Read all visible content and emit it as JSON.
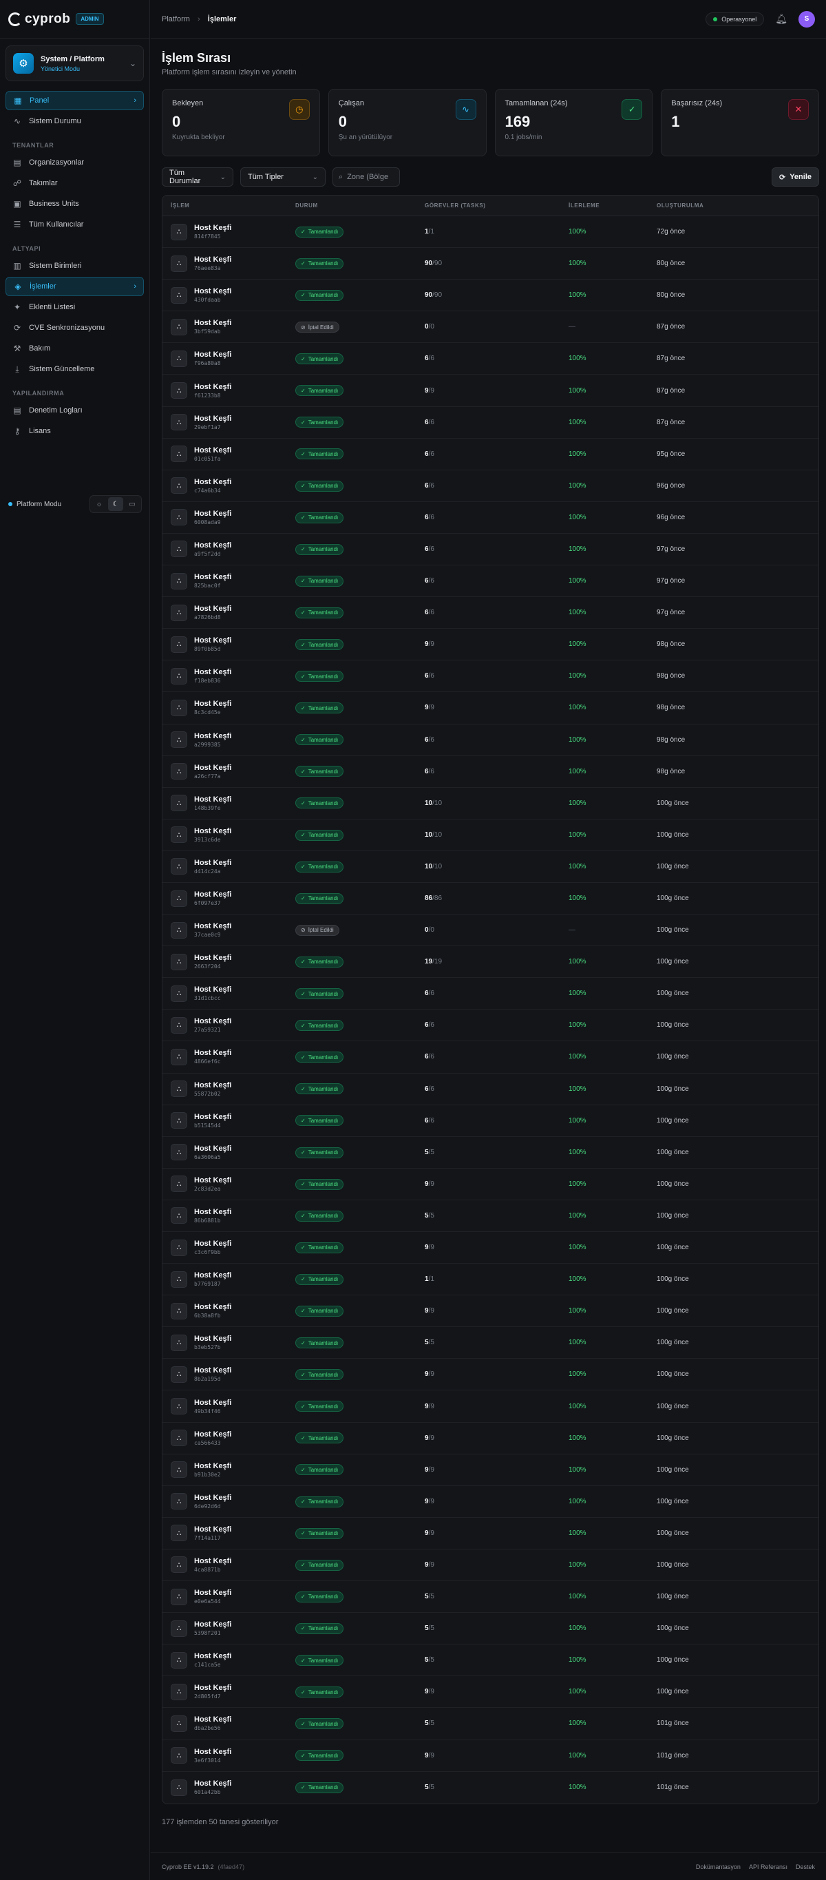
{
  "app": {
    "logo": "cyprob",
    "badge": "ADMIN"
  },
  "tenant": {
    "name": "System / Platform",
    "mode": "Yönetici Modu"
  },
  "nav": {
    "top": [
      {
        "label": "Panel",
        "icon": "grid-icon",
        "glyph": "▦",
        "active": true
      },
      {
        "label": "Sistem Durumu",
        "icon": "activity-icon",
        "glyph": "∿",
        "active": false
      }
    ],
    "sections": [
      {
        "title": "TENANTLAR",
        "items": [
          {
            "label": "Organizasyonlar",
            "icon": "building-icon",
            "glyph": "▤"
          },
          {
            "label": "Takımlar",
            "icon": "users-icon",
            "glyph": "☍"
          },
          {
            "label": "Business Units",
            "icon": "briefcase-icon",
            "glyph": "▣"
          },
          {
            "label": "Tüm Kullanıcılar",
            "icon": "user-list-icon",
            "glyph": "☰"
          }
        ]
      },
      {
        "title": "ALTYAPI",
        "items": [
          {
            "label": "Sistem Birimleri",
            "icon": "server-icon",
            "glyph": "▥"
          },
          {
            "label": "İşlemler",
            "icon": "layers-icon",
            "glyph": "◈",
            "active": true
          },
          {
            "label": "Eklenti Listesi",
            "icon": "puzzle-icon",
            "glyph": "✦"
          },
          {
            "label": "CVE Senkronizasyonu",
            "icon": "sync-icon",
            "glyph": "⟳"
          },
          {
            "label": "Bakım",
            "icon": "wrench-icon",
            "glyph": "⚒"
          },
          {
            "label": "Sistem Güncelleme",
            "icon": "download-icon",
            "glyph": "⤓"
          }
        ]
      },
      {
        "title": "YAPILANDIRMA",
        "items": [
          {
            "label": "Denetim Logları",
            "icon": "log-icon",
            "glyph": "▤"
          },
          {
            "label": "Lisans",
            "icon": "key-icon",
            "glyph": "⚷"
          }
        ]
      }
    ],
    "platform_mode": "Platform Modu"
  },
  "topbar": {
    "crumb_root": "Platform",
    "crumb_current": "İşlemler",
    "status": "Operasyonel",
    "avatar_initial": "S"
  },
  "page": {
    "title": "İşlem Sırası",
    "subtitle": "Platform işlem sırasını izleyin ve yönetin"
  },
  "stats": [
    {
      "label": "Bekleyen",
      "value": "0",
      "hint": "Kuyrukta bekliyor",
      "icon": "clock-icon",
      "glyph": "◷",
      "color": "#f59e0b",
      "bg": "#3a2a0d",
      "border": "#6b4a12"
    },
    {
      "label": "Çalışan",
      "value": "0",
      "hint": "Şu an yürütülüyor",
      "icon": "pulse-icon",
      "glyph": "∿",
      "color": "#38bdf8",
      "bg": "#0d2a36",
      "border": "#14526b"
    },
    {
      "label": "Tamamlanan (24s)",
      "value": "169",
      "hint": "0.1 jobs/min",
      "icon": "check-circle-icon",
      "glyph": "✓",
      "color": "#4ade80",
      "bg": "#0f3a2b",
      "border": "#166343"
    },
    {
      "label": "Başarısız (24s)",
      "value": "1",
      "hint": "",
      "icon": "x-circle-icon",
      "glyph": "✕",
      "color": "#f43f5e",
      "bg": "#3a1019",
      "border": "#6b1a2b"
    }
  ],
  "filters": {
    "status": "Tüm Durumlar",
    "type": "Tüm Tipler",
    "zone_placeholder": "Zone (Bölge",
    "refresh": "Yenile"
  },
  "table": {
    "headers": [
      "İŞLEM",
      "DURUM",
      "GÖREVLER (TASKS)",
      "İLERLEME",
      "OLUŞTURULMA"
    ],
    "rows": [
      {
        "name": "Host Keşfi",
        "id": "814f7845",
        "status": "Tamamlandı",
        "done": "1",
        "total": "1",
        "progress": "100%",
        "created": "72g önce"
      },
      {
        "name": "Host Keşfi",
        "id": "76aee83a",
        "status": "Tamamlandı",
        "done": "90",
        "total": "90",
        "progress": "100%",
        "created": "80g önce"
      },
      {
        "name": "Host Keşfi",
        "id": "430fdaab",
        "status": "Tamamlandı",
        "done": "90",
        "total": "90",
        "progress": "100%",
        "created": "80g önce"
      },
      {
        "name": "Host Keşfi",
        "id": "3bf59dab",
        "status": "İptal Edildi",
        "done": "0",
        "total": "0",
        "progress": "—",
        "created": "87g önce"
      },
      {
        "name": "Host Keşfi",
        "id": "f96a80a8",
        "status": "Tamamlandı",
        "done": "6",
        "total": "6",
        "progress": "100%",
        "created": "87g önce"
      },
      {
        "name": "Host Keşfi",
        "id": "f61233b8",
        "status": "Tamamlandı",
        "done": "9",
        "total": "9",
        "progress": "100%",
        "created": "87g önce"
      },
      {
        "name": "Host Keşfi",
        "id": "29ebf1a7",
        "status": "Tamamlandı",
        "done": "6",
        "total": "6",
        "progress": "100%",
        "created": "87g önce"
      },
      {
        "name": "Host Keşfi",
        "id": "01c051fa",
        "status": "Tamamlandı",
        "done": "6",
        "total": "6",
        "progress": "100%",
        "created": "95g önce"
      },
      {
        "name": "Host Keşfi",
        "id": "c74a6b34",
        "status": "Tamamlandı",
        "done": "6",
        "total": "6",
        "progress": "100%",
        "created": "96g önce"
      },
      {
        "name": "Host Keşfi",
        "id": "6008ada9",
        "status": "Tamamlandı",
        "done": "6",
        "total": "6",
        "progress": "100%",
        "created": "96g önce"
      },
      {
        "name": "Host Keşfi",
        "id": "a9f5f2dd",
        "status": "Tamamlandı",
        "done": "6",
        "total": "6",
        "progress": "100%",
        "created": "97g önce"
      },
      {
        "name": "Host Keşfi",
        "id": "825bac0f",
        "status": "Tamamlandı",
        "done": "6",
        "total": "6",
        "progress": "100%",
        "created": "97g önce"
      },
      {
        "name": "Host Keşfi",
        "id": "a7826bd8",
        "status": "Tamamlandı",
        "done": "6",
        "total": "6",
        "progress": "100%",
        "created": "97g önce"
      },
      {
        "name": "Host Keşfi",
        "id": "89f0b85d",
        "status": "Tamamlandı",
        "done": "9",
        "total": "9",
        "progress": "100%",
        "created": "98g önce"
      },
      {
        "name": "Host Keşfi",
        "id": "f18eb836",
        "status": "Tamamlandı",
        "done": "6",
        "total": "6",
        "progress": "100%",
        "created": "98g önce"
      },
      {
        "name": "Host Keşfi",
        "id": "8c3cd45e",
        "status": "Tamamlandı",
        "done": "9",
        "total": "9",
        "progress": "100%",
        "created": "98g önce"
      },
      {
        "name": "Host Keşfi",
        "id": "a2999385",
        "status": "Tamamlandı",
        "done": "6",
        "total": "6",
        "progress": "100%",
        "created": "98g önce"
      },
      {
        "name": "Host Keşfi",
        "id": "a26cf77a",
        "status": "Tamamlandı",
        "done": "6",
        "total": "6",
        "progress": "100%",
        "created": "98g önce"
      },
      {
        "name": "Host Keşfi",
        "id": "148b39fe",
        "status": "Tamamlandı",
        "done": "10",
        "total": "10",
        "progress": "100%",
        "created": "100g önce"
      },
      {
        "name": "Host Keşfi",
        "id": "3913c6de",
        "status": "Tamamlandı",
        "done": "10",
        "total": "10",
        "progress": "100%",
        "created": "100g önce"
      },
      {
        "name": "Host Keşfi",
        "id": "d414c24a",
        "status": "Tamamlandı",
        "done": "10",
        "total": "10",
        "progress": "100%",
        "created": "100g önce"
      },
      {
        "name": "Host Keşfi",
        "id": "6f097e37",
        "status": "Tamamlandı",
        "done": "86",
        "total": "86",
        "progress": "100%",
        "created": "100g önce"
      },
      {
        "name": "Host Keşfi",
        "id": "37cae0c9",
        "status": "İptal Edildi",
        "done": "0",
        "total": "0",
        "progress": "—",
        "created": "100g önce"
      },
      {
        "name": "Host Keşfi",
        "id": "2663f204",
        "status": "Tamamlandı",
        "done": "19",
        "total": "19",
        "progress": "100%",
        "created": "100g önce"
      },
      {
        "name": "Host Keşfi",
        "id": "31d1cbcc",
        "status": "Tamamlandı",
        "done": "6",
        "total": "6",
        "progress": "100%",
        "created": "100g önce"
      },
      {
        "name": "Host Keşfi",
        "id": "27a59321",
        "status": "Tamamlandı",
        "done": "6",
        "total": "6",
        "progress": "100%",
        "created": "100g önce"
      },
      {
        "name": "Host Keşfi",
        "id": "4866ef6c",
        "status": "Tamamlandı",
        "done": "6",
        "total": "6",
        "progress": "100%",
        "created": "100g önce"
      },
      {
        "name": "Host Keşfi",
        "id": "55872b02",
        "status": "Tamamlandı",
        "done": "6",
        "total": "6",
        "progress": "100%",
        "created": "100g önce"
      },
      {
        "name": "Host Keşfi",
        "id": "b51545d4",
        "status": "Tamamlandı",
        "done": "6",
        "total": "6",
        "progress": "100%",
        "created": "100g önce"
      },
      {
        "name": "Host Keşfi",
        "id": "6a3606a5",
        "status": "Tamamlandı",
        "done": "5",
        "total": "5",
        "progress": "100%",
        "created": "100g önce"
      },
      {
        "name": "Host Keşfi",
        "id": "2c83d2ea",
        "status": "Tamamlandı",
        "done": "9",
        "total": "9",
        "progress": "100%",
        "created": "100g önce"
      },
      {
        "name": "Host Keşfi",
        "id": "86b6881b",
        "status": "Tamamlandı",
        "done": "5",
        "total": "5",
        "progress": "100%",
        "created": "100g önce"
      },
      {
        "name": "Host Keşfi",
        "id": "c3c6f9bb",
        "status": "Tamamlandı",
        "done": "9",
        "total": "9",
        "progress": "100%",
        "created": "100g önce"
      },
      {
        "name": "Host Keşfi",
        "id": "b7769187",
        "status": "Tamamlandı",
        "done": "1",
        "total": "1",
        "progress": "100%",
        "created": "100g önce"
      },
      {
        "name": "Host Keşfi",
        "id": "6b38a8fb",
        "status": "Tamamlandı",
        "done": "9",
        "total": "9",
        "progress": "100%",
        "created": "100g önce"
      },
      {
        "name": "Host Keşfi",
        "id": "b3eb527b",
        "status": "Tamamlandı",
        "done": "5",
        "total": "5",
        "progress": "100%",
        "created": "100g önce"
      },
      {
        "name": "Host Keşfi",
        "id": "8b2a195d",
        "status": "Tamamlandı",
        "done": "9",
        "total": "9",
        "progress": "100%",
        "created": "100g önce"
      },
      {
        "name": "Host Keşfi",
        "id": "49b34f46",
        "status": "Tamamlandı",
        "done": "9",
        "total": "9",
        "progress": "100%",
        "created": "100g önce"
      },
      {
        "name": "Host Keşfi",
        "id": "ca566433",
        "status": "Tamamlandı",
        "done": "9",
        "total": "9",
        "progress": "100%",
        "created": "100g önce"
      },
      {
        "name": "Host Keşfi",
        "id": "b91b30e2",
        "status": "Tamamlandı",
        "done": "9",
        "total": "9",
        "progress": "100%",
        "created": "100g önce"
      },
      {
        "name": "Host Keşfi",
        "id": "6de92d6d",
        "status": "Tamamlandı",
        "done": "9",
        "total": "9",
        "progress": "100%",
        "created": "100g önce"
      },
      {
        "name": "Host Keşfi",
        "id": "7f14a117",
        "status": "Tamamlandı",
        "done": "9",
        "total": "9",
        "progress": "100%",
        "created": "100g önce"
      },
      {
        "name": "Host Keşfi",
        "id": "4ca8871b",
        "status": "Tamamlandı",
        "done": "9",
        "total": "9",
        "progress": "100%",
        "created": "100g önce"
      },
      {
        "name": "Host Keşfi",
        "id": "e0e6a544",
        "status": "Tamamlandı",
        "done": "5",
        "total": "5",
        "progress": "100%",
        "created": "100g önce"
      },
      {
        "name": "Host Keşfi",
        "id": "5398f201",
        "status": "Tamamlandı",
        "done": "5",
        "total": "5",
        "progress": "100%",
        "created": "100g önce"
      },
      {
        "name": "Host Keşfi",
        "id": "c141ca5e",
        "status": "Tamamlandı",
        "done": "5",
        "total": "5",
        "progress": "100%",
        "created": "100g önce"
      },
      {
        "name": "Host Keşfi",
        "id": "2d805fd7",
        "status": "Tamamlandı",
        "done": "9",
        "total": "9",
        "progress": "100%",
        "created": "100g önce"
      },
      {
        "name": "Host Keşfi",
        "id": "dba2be56",
        "status": "Tamamlandı",
        "done": "5",
        "total": "5",
        "progress": "100%",
        "created": "101g önce"
      },
      {
        "name": "Host Keşfi",
        "id": "3e6f3014",
        "status": "Tamamlandı",
        "done": "9",
        "total": "9",
        "progress": "100%",
        "created": "101g önce"
      },
      {
        "name": "Host Keşfi",
        "id": "601a42bb",
        "status": "Tamamlandı",
        "done": "5",
        "total": "5",
        "progress": "100%",
        "created": "101g önce"
      }
    ]
  },
  "summary": "177 işlemden 50 tanesi gösteriliyor",
  "footer": {
    "version": "Cyprob EE v1.19.2",
    "hash": "(4faed47)",
    "links": [
      "Dokümantasyon",
      "API Referansı",
      "Destek"
    ]
  }
}
